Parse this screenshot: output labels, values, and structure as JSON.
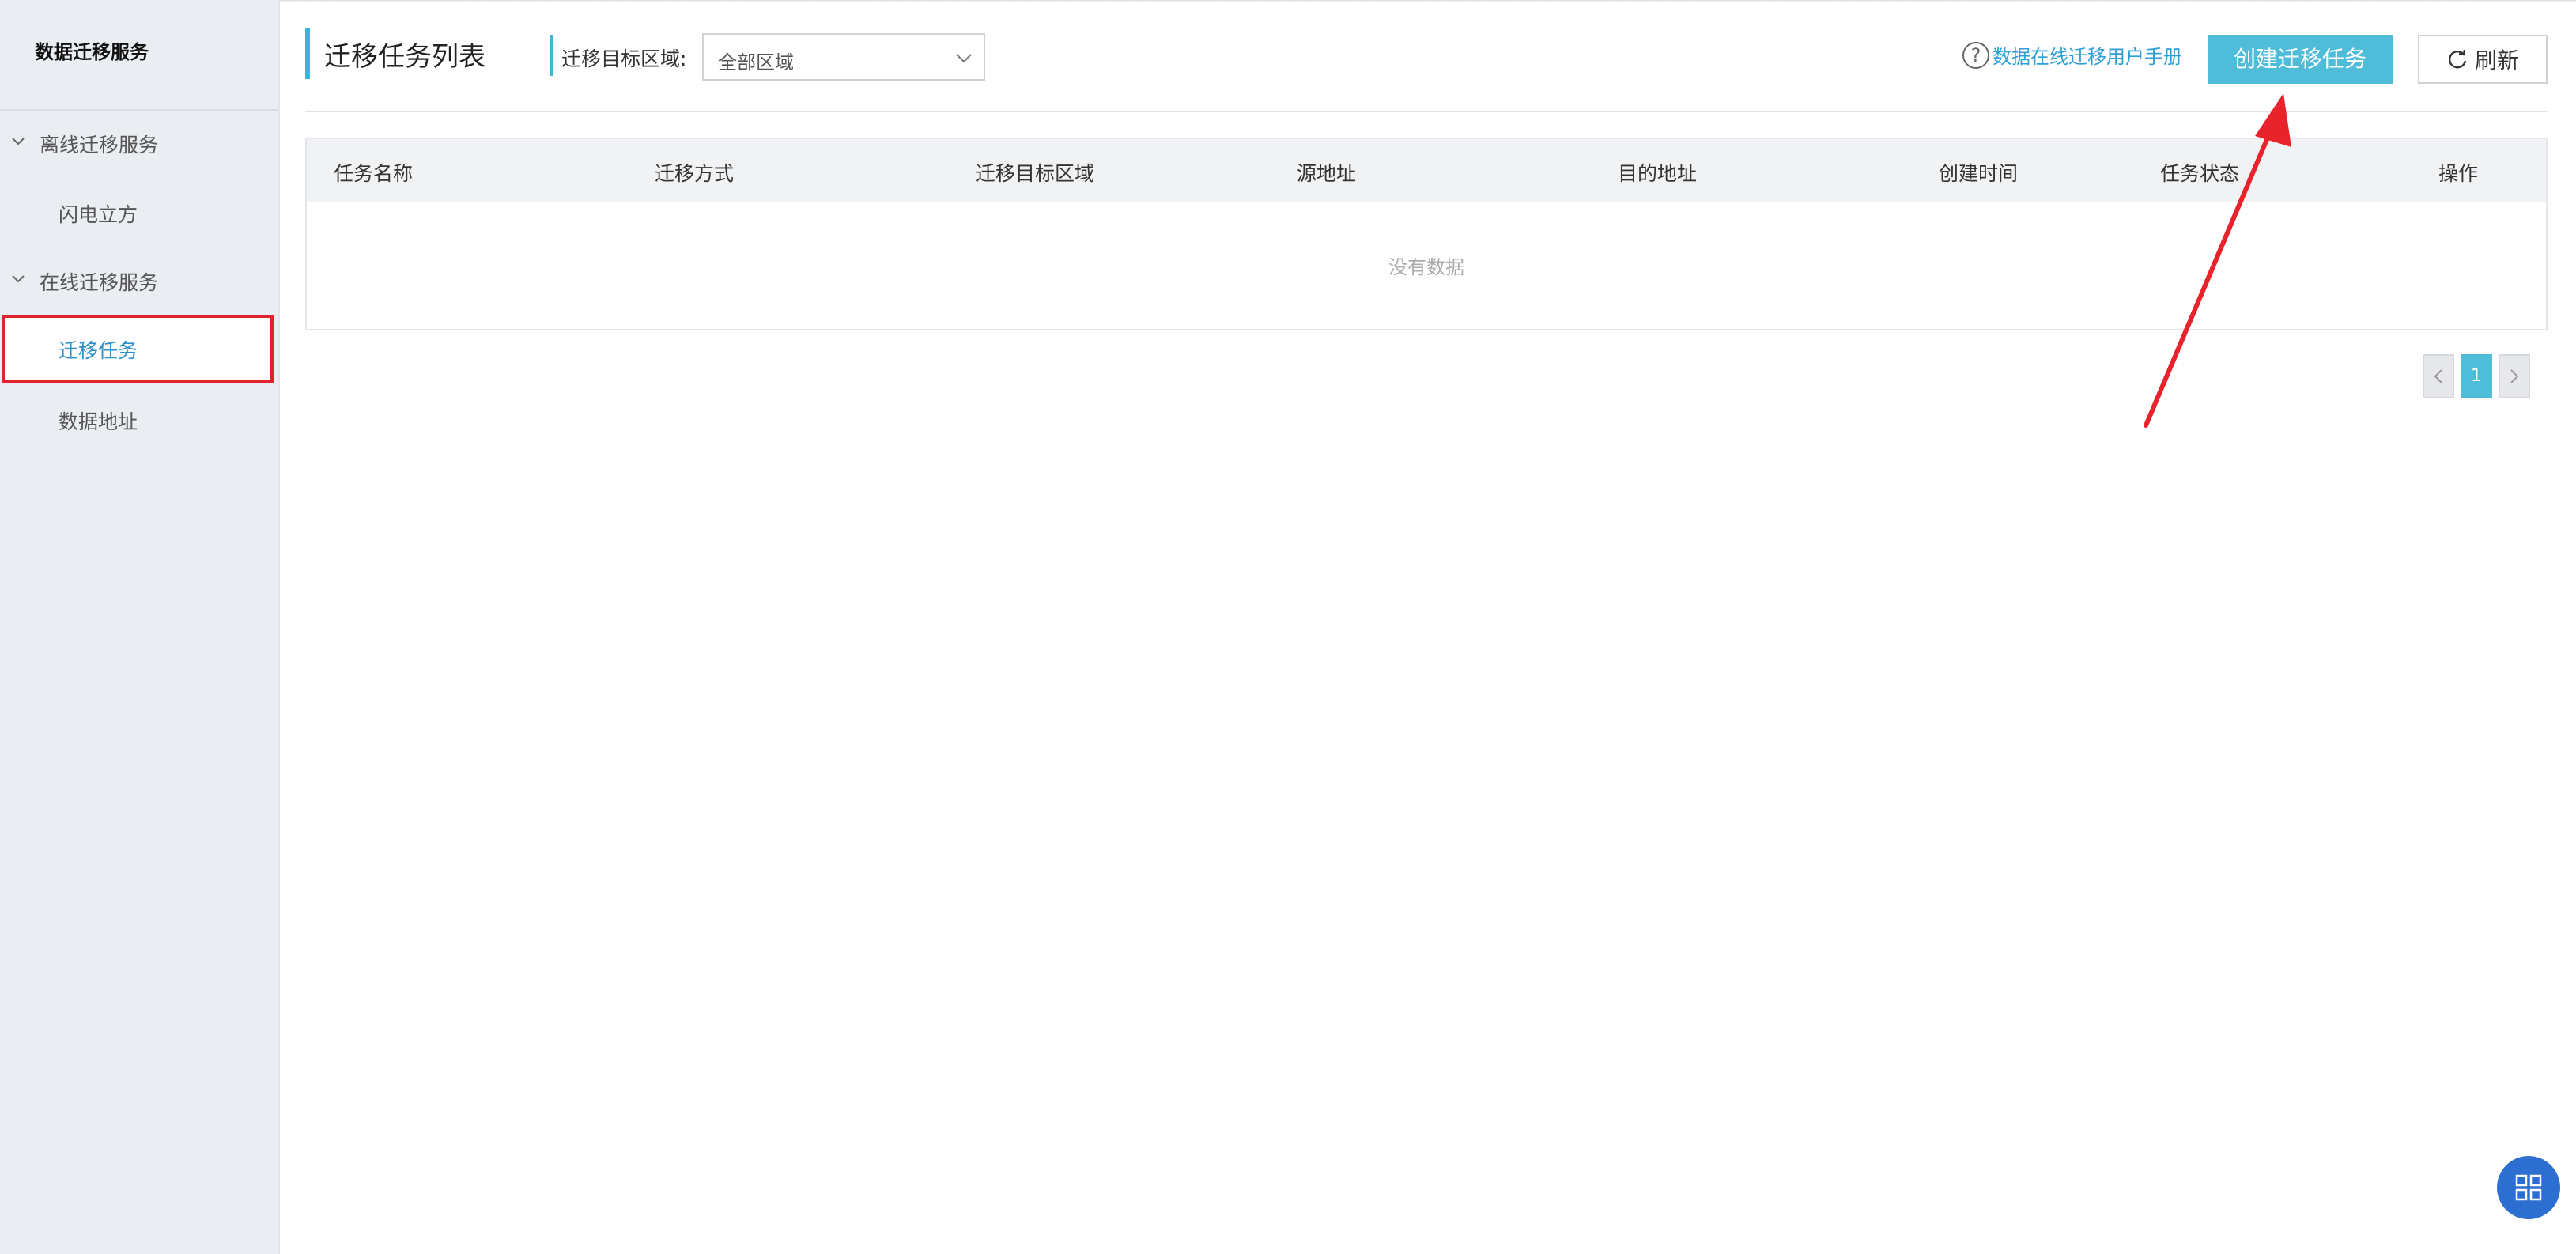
{
  "sidebar": {
    "title": "数据迁移服务",
    "groups": [
      {
        "label": "离线迁移服务",
        "items": [
          "闪电立方"
        ]
      },
      {
        "label": "在线迁移服务",
        "items": [
          "迁移任务",
          "数据地址"
        ]
      }
    ],
    "active_item": "迁移任务"
  },
  "header": {
    "title": "迁移任务列表",
    "filter_label": "迁移目标区域:",
    "filter_value": "全部区域",
    "help_link": "数据在线迁移用户手册",
    "help_icon": "?",
    "create_button": "创建迁移任务",
    "refresh_button": "刷新"
  },
  "table": {
    "columns": [
      "任务名称",
      "迁移方式",
      "迁移目标区域",
      "源地址",
      "目的地址",
      "创建时间",
      "任务状态",
      "操作"
    ],
    "empty_text": "没有数据"
  },
  "pagination": {
    "current": "1"
  },
  "colors": {
    "accent": "#4fbdd9",
    "link": "#2c9fd6",
    "highlight": "#e0232f",
    "fab": "#2c6fd1"
  },
  "icons": {
    "fab": "grid-icon",
    "refresh": "refresh-icon"
  }
}
